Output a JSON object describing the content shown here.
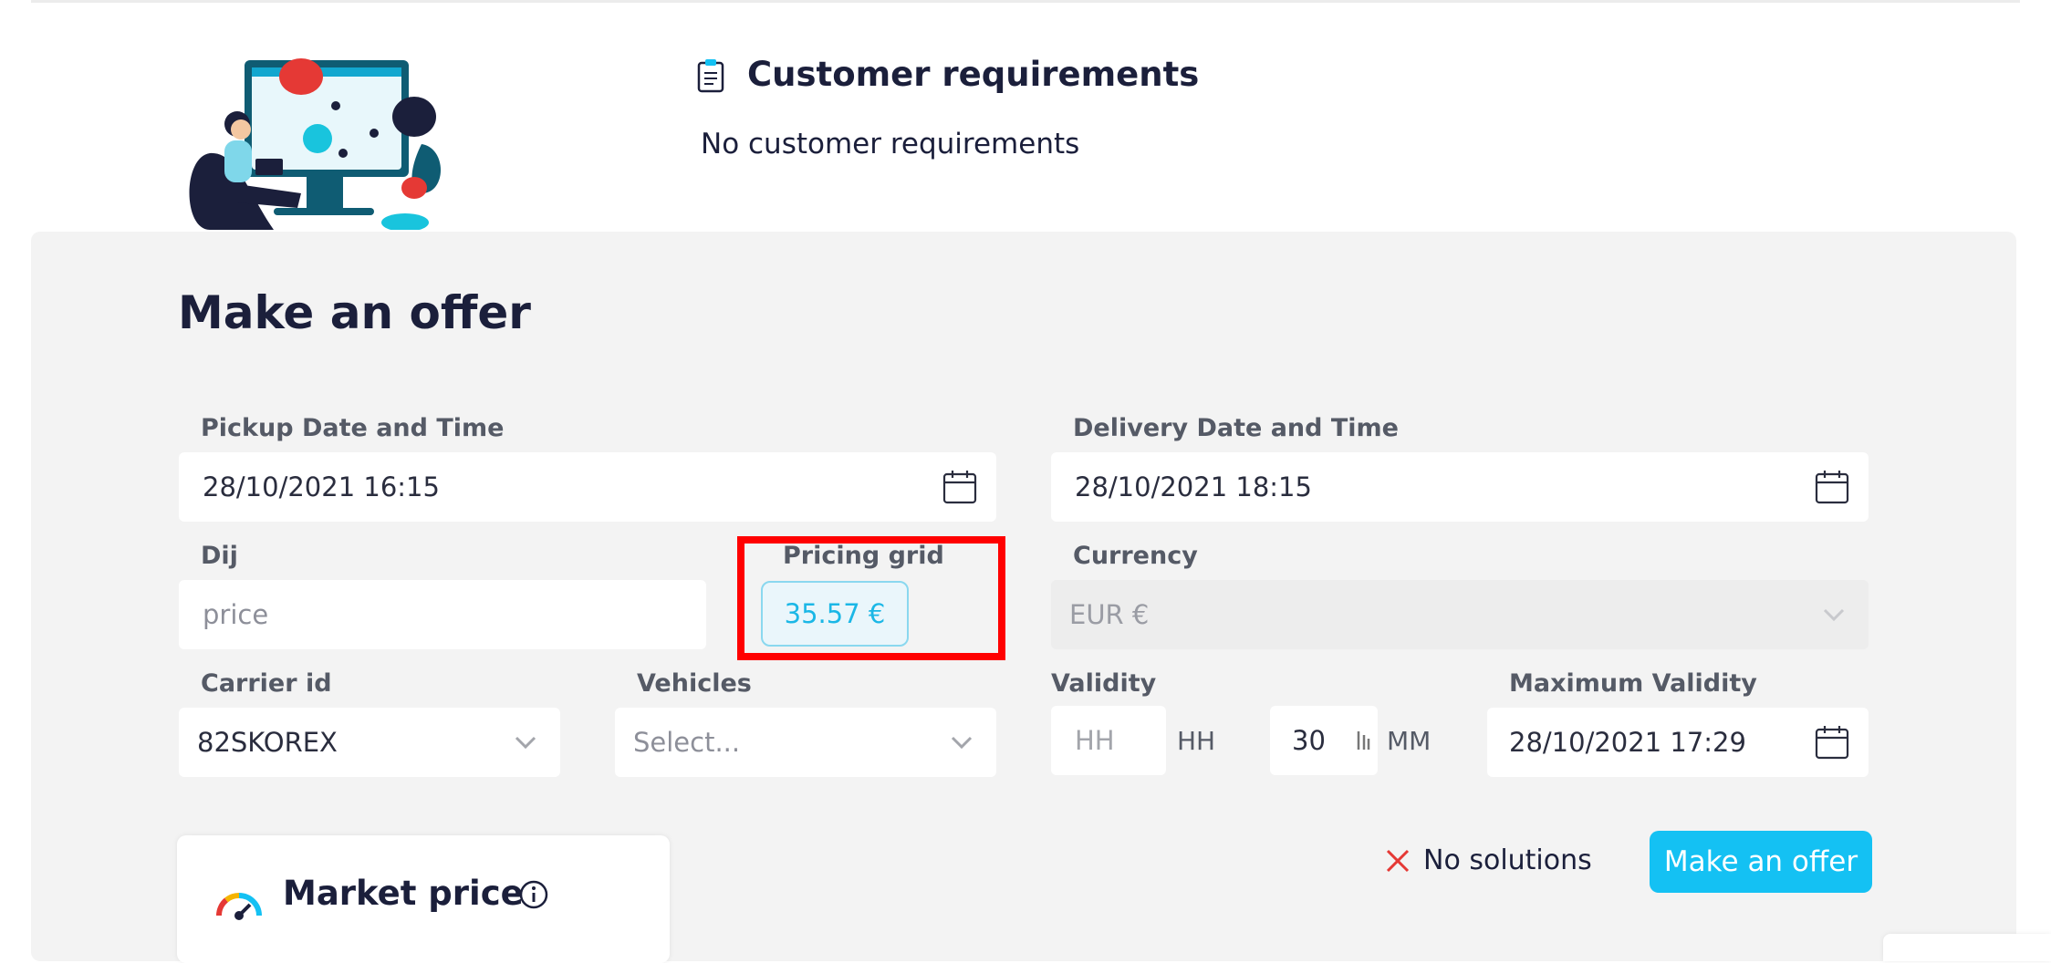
{
  "requirements": {
    "title": "Customer requirements",
    "text": "No customer requirements"
  },
  "offer": {
    "title": "Make an offer",
    "pickup": {
      "label": "Pickup Date and Time",
      "value": "28/10/2021 16:15"
    },
    "delivery": {
      "label": "Delivery Date and Time",
      "value": "28/10/2021 18:15"
    },
    "dij": {
      "label": "Dij",
      "placeholder": "price"
    },
    "pricing_grid": {
      "label": "Pricing grid",
      "value": "35.57 €"
    },
    "currency": {
      "label": "Currency",
      "value": "EUR €"
    },
    "carrier": {
      "label": "Carrier id",
      "value": "82SKOREX"
    },
    "vehicles": {
      "label": "Vehicles",
      "placeholder": "Select..."
    },
    "validity": {
      "label": "Validity",
      "hours_placeholder": "HH",
      "hours_unit": "HH",
      "minutes_value": "30",
      "minutes_unit": "MM"
    },
    "max_validity": {
      "label": "Maximum Validity",
      "value": "28/10/2021 17:29"
    },
    "no_solutions": "No solutions",
    "submit_label": "Make an offer"
  },
  "market": {
    "title": "Market price"
  },
  "colors": {
    "primary_button": "#14c1f3",
    "highlight": "#ff0000",
    "navy": "#1b1f3b",
    "panel": "#f3f3f3",
    "error": "#e53935"
  },
  "icons": {
    "requirements": "clipboard-icon",
    "date": "calendar-icon",
    "dropdown": "chevron-down-icon",
    "stepper": "stepper-icon",
    "error": "close-icon",
    "market": "gauge-icon",
    "info": "info-icon"
  }
}
